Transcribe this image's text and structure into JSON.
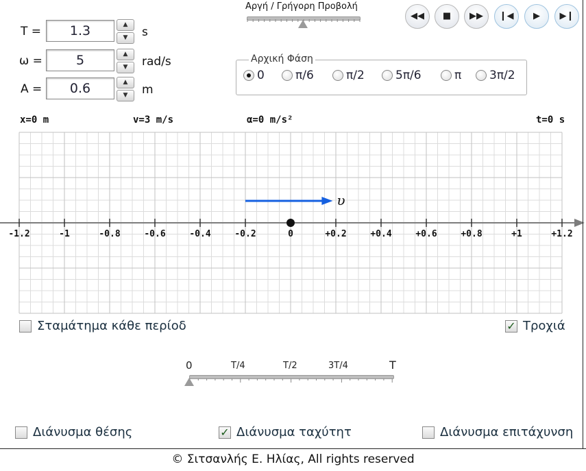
{
  "params": {
    "T": {
      "label": "T =",
      "value": "1.3",
      "unit": "s"
    },
    "omega": {
      "label": "ω =",
      "value": "5",
      "unit": "rad/s"
    },
    "A": {
      "label": "A =",
      "value": "0.6",
      "unit": "m"
    }
  },
  "speed": {
    "title": "Αργή / Γρήγορη Προβολή",
    "level": 0.5
  },
  "media_buttons": [
    "rewind-icon",
    "stop-icon",
    "fast-forward-icon",
    "step-back-icon",
    "play-icon",
    "step-forward-icon"
  ],
  "phase": {
    "title": "Αρχική Φάση",
    "options": [
      "0",
      "π/6",
      "π/2",
      "5π/6",
      "π",
      "3π/2"
    ],
    "selected": "0"
  },
  "readouts": {
    "x": "x=0 m",
    "v": "v=3 m/s",
    "a": "α=0 m/s²",
    "t": "t=0 s"
  },
  "chart_data": {
    "type": "scatter",
    "x_ticks": [
      "-1.2",
      "-1",
      "-0.8",
      "-0.6",
      "-0.4",
      "-0.2",
      "0",
      "+0.2",
      "+0.4",
      "+0.6",
      "+0.8",
      "+1",
      "+1.2"
    ],
    "xlim": [
      -1.2,
      1.2
    ],
    "particle_x": 0,
    "velocity_vector": {
      "from": -0.2,
      "to": 0.18,
      "label": "υ",
      "color": "#1560e0"
    },
    "grid": true
  },
  "checkboxes": {
    "stop_each_period": {
      "label": "Σταμάτημα κάθε περίοδ",
      "checked": false
    },
    "trajectory": {
      "label": "Τροχιά",
      "checked": true
    },
    "position_vector": {
      "label": "Διάνυσμα θέσης",
      "checked": false
    },
    "velocity_vector": {
      "label": "Διάνυσμα ταχύτητ",
      "checked": true
    },
    "accel_vector": {
      "label": "Διάνυσμα επιτάχυνση",
      "checked": false
    }
  },
  "period_slider": {
    "labels": [
      "0",
      "T/4",
      "T/2",
      "3T/4",
      "T"
    ],
    "position": 0
  },
  "footer": "© Σιτσανλής Ε. Ηλίας, All rights reserved"
}
